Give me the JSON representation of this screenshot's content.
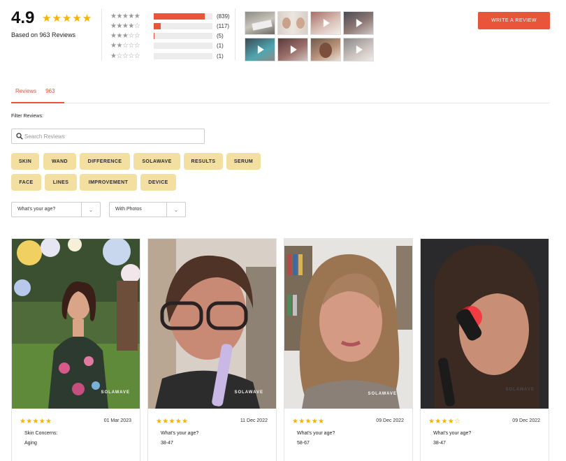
{
  "summary": {
    "average": "4.9",
    "stars": "★★★★★",
    "based_on": "Based on 963 Reviews"
  },
  "distribution": [
    {
      "stars": "★★★★★",
      "count": "(839)",
      "fraction": 0.871
    },
    {
      "stars": "★★★★☆",
      "count": "(117)",
      "fraction": 0.121
    },
    {
      "stars": "★★★☆☆",
      "count": "(5)",
      "fraction": 0.012
    },
    {
      "stars": "★★☆☆☆",
      "count": "(1)",
      "fraction": 0.0
    },
    {
      "stars": "★☆☆☆☆",
      "count": "(1)",
      "fraction": 0.0
    }
  ],
  "media_thumbs": [
    {
      "kind": "photo",
      "icon": "product-box"
    },
    {
      "kind": "photo",
      "icon": "before-after"
    },
    {
      "kind": "video",
      "icon": "play-icon"
    },
    {
      "kind": "video",
      "icon": "play-icon"
    },
    {
      "kind": "video",
      "icon": "play-icon"
    },
    {
      "kind": "video",
      "icon": "play-icon"
    },
    {
      "kind": "photo",
      "icon": "face"
    },
    {
      "kind": "video",
      "icon": "play-icon"
    }
  ],
  "write_review_label": "WRITE A REVIEW",
  "tabs": [
    {
      "label": "Reviews",
      "count": "963"
    }
  ],
  "filter_label": "Filter Reviews:",
  "search": {
    "placeholder": "Search Reviews"
  },
  "chips": [
    "SKIN",
    "WAND",
    "DIFFERENCE",
    "SOLAWAVE",
    "RESULTS",
    "SERUM",
    "FACE",
    "LINES",
    "IMPROVEMENT",
    "DEVICE"
  ],
  "selects": [
    {
      "value": "What's your age?"
    },
    {
      "value": "With Photos"
    }
  ],
  "reviews": [
    {
      "stars": "★★★★★",
      "date": "01 Mar 2023",
      "question": "Skin Concerns:",
      "answer": "Aging",
      "watermark": "SOLAWAVE"
    },
    {
      "stars": "★★★★★",
      "date": "11 Dec 2022",
      "question": "What's your age?",
      "answer": "38-47",
      "watermark": "SOLAWAVE"
    },
    {
      "stars": "★★★★★",
      "date": "09 Dec 2022",
      "question": "What's your age?",
      "answer": "58-67",
      "watermark": "SOLAWAVE"
    },
    {
      "stars": "★★★★☆",
      "date": "09 Dec 2022",
      "question": "What's your age?",
      "answer": "38-47",
      "watermark": "SOLAWAVE"
    }
  ],
  "colors": {
    "accent": "#e8553a",
    "star": "#f5b400",
    "chip": "#f3dfa0"
  }
}
